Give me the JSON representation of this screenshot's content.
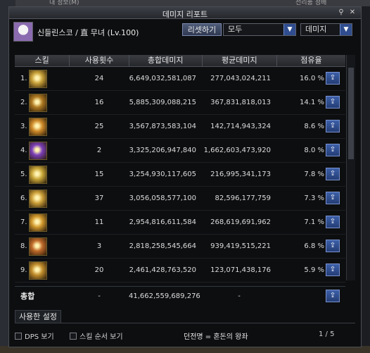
{
  "window": {
    "title": "데미지 리포트"
  },
  "header": {
    "character": "신들린스코 / 直 무녀 (Lv.100)",
    "reset_label": "리셋하기",
    "filter_target": "모두",
    "filter_type": "데미지"
  },
  "table": {
    "columns": [
      "스킬",
      "사용횟수",
      "총합데미지",
      "평균데미지",
      "점유율"
    ],
    "rows": [
      {
        "rank": "1.",
        "uses": "24",
        "total": "6,649,032,581,087",
        "avg": "277,043,024,211",
        "share": "16.0 %"
      },
      {
        "rank": "2.",
        "uses": "16",
        "total": "5,885,309,088,215",
        "avg": "367,831,818,013",
        "share": "14.1 %"
      },
      {
        "rank": "3.",
        "uses": "25",
        "total": "3,567,873,583,104",
        "avg": "142,714,943,324",
        "share": "8.6 %"
      },
      {
        "rank": "4.",
        "uses": "2",
        "total": "3,325,206,947,840",
        "avg": "1,662,603,473,920",
        "share": "8.0 %"
      },
      {
        "rank": "5.",
        "uses": "15",
        "total": "3,254,930,117,605",
        "avg": "216,995,341,173",
        "share": "7.8 %"
      },
      {
        "rank": "6.",
        "uses": "37",
        "total": "3,056,058,577,100",
        "avg": "82,596,177,759",
        "share": "7.3 %"
      },
      {
        "rank": "7.",
        "uses": "11",
        "total": "2,954,816,611,584",
        "avg": "268,619,691,962",
        "share": "7.1 %"
      },
      {
        "rank": "8.",
        "uses": "3",
        "total": "2,818,258,545,664",
        "avg": "939,419,515,221",
        "share": "6.8 %"
      },
      {
        "rank": "9.",
        "uses": "20",
        "total": "2,461,428,763,520",
        "avg": "123,071,438,176",
        "share": "5.9 %"
      }
    ],
    "skill_icon_colors": [
      "#c9a23a",
      "#b07a22",
      "#d08b2a",
      "#7b3fb8",
      "#caa83a",
      "#cfa23b",
      "#d39a2e",
      "#c06a2a",
      "#c4902e"
    ]
  },
  "total": {
    "label": "총합",
    "uses": "-",
    "total": "41,662,559,689,276",
    "avg": "-"
  },
  "settings": {
    "tab_label": "사용한 설정",
    "dps_label": "DPS 보기",
    "order_label": "스킬 순서 보기",
    "dungeon": "던전명 = 혼돈의 왕좌"
  },
  "pager": {
    "text": "1 / 5"
  },
  "background": {
    "top_left": "내 정보(M)",
    "top_right": "선리품 정배"
  }
}
